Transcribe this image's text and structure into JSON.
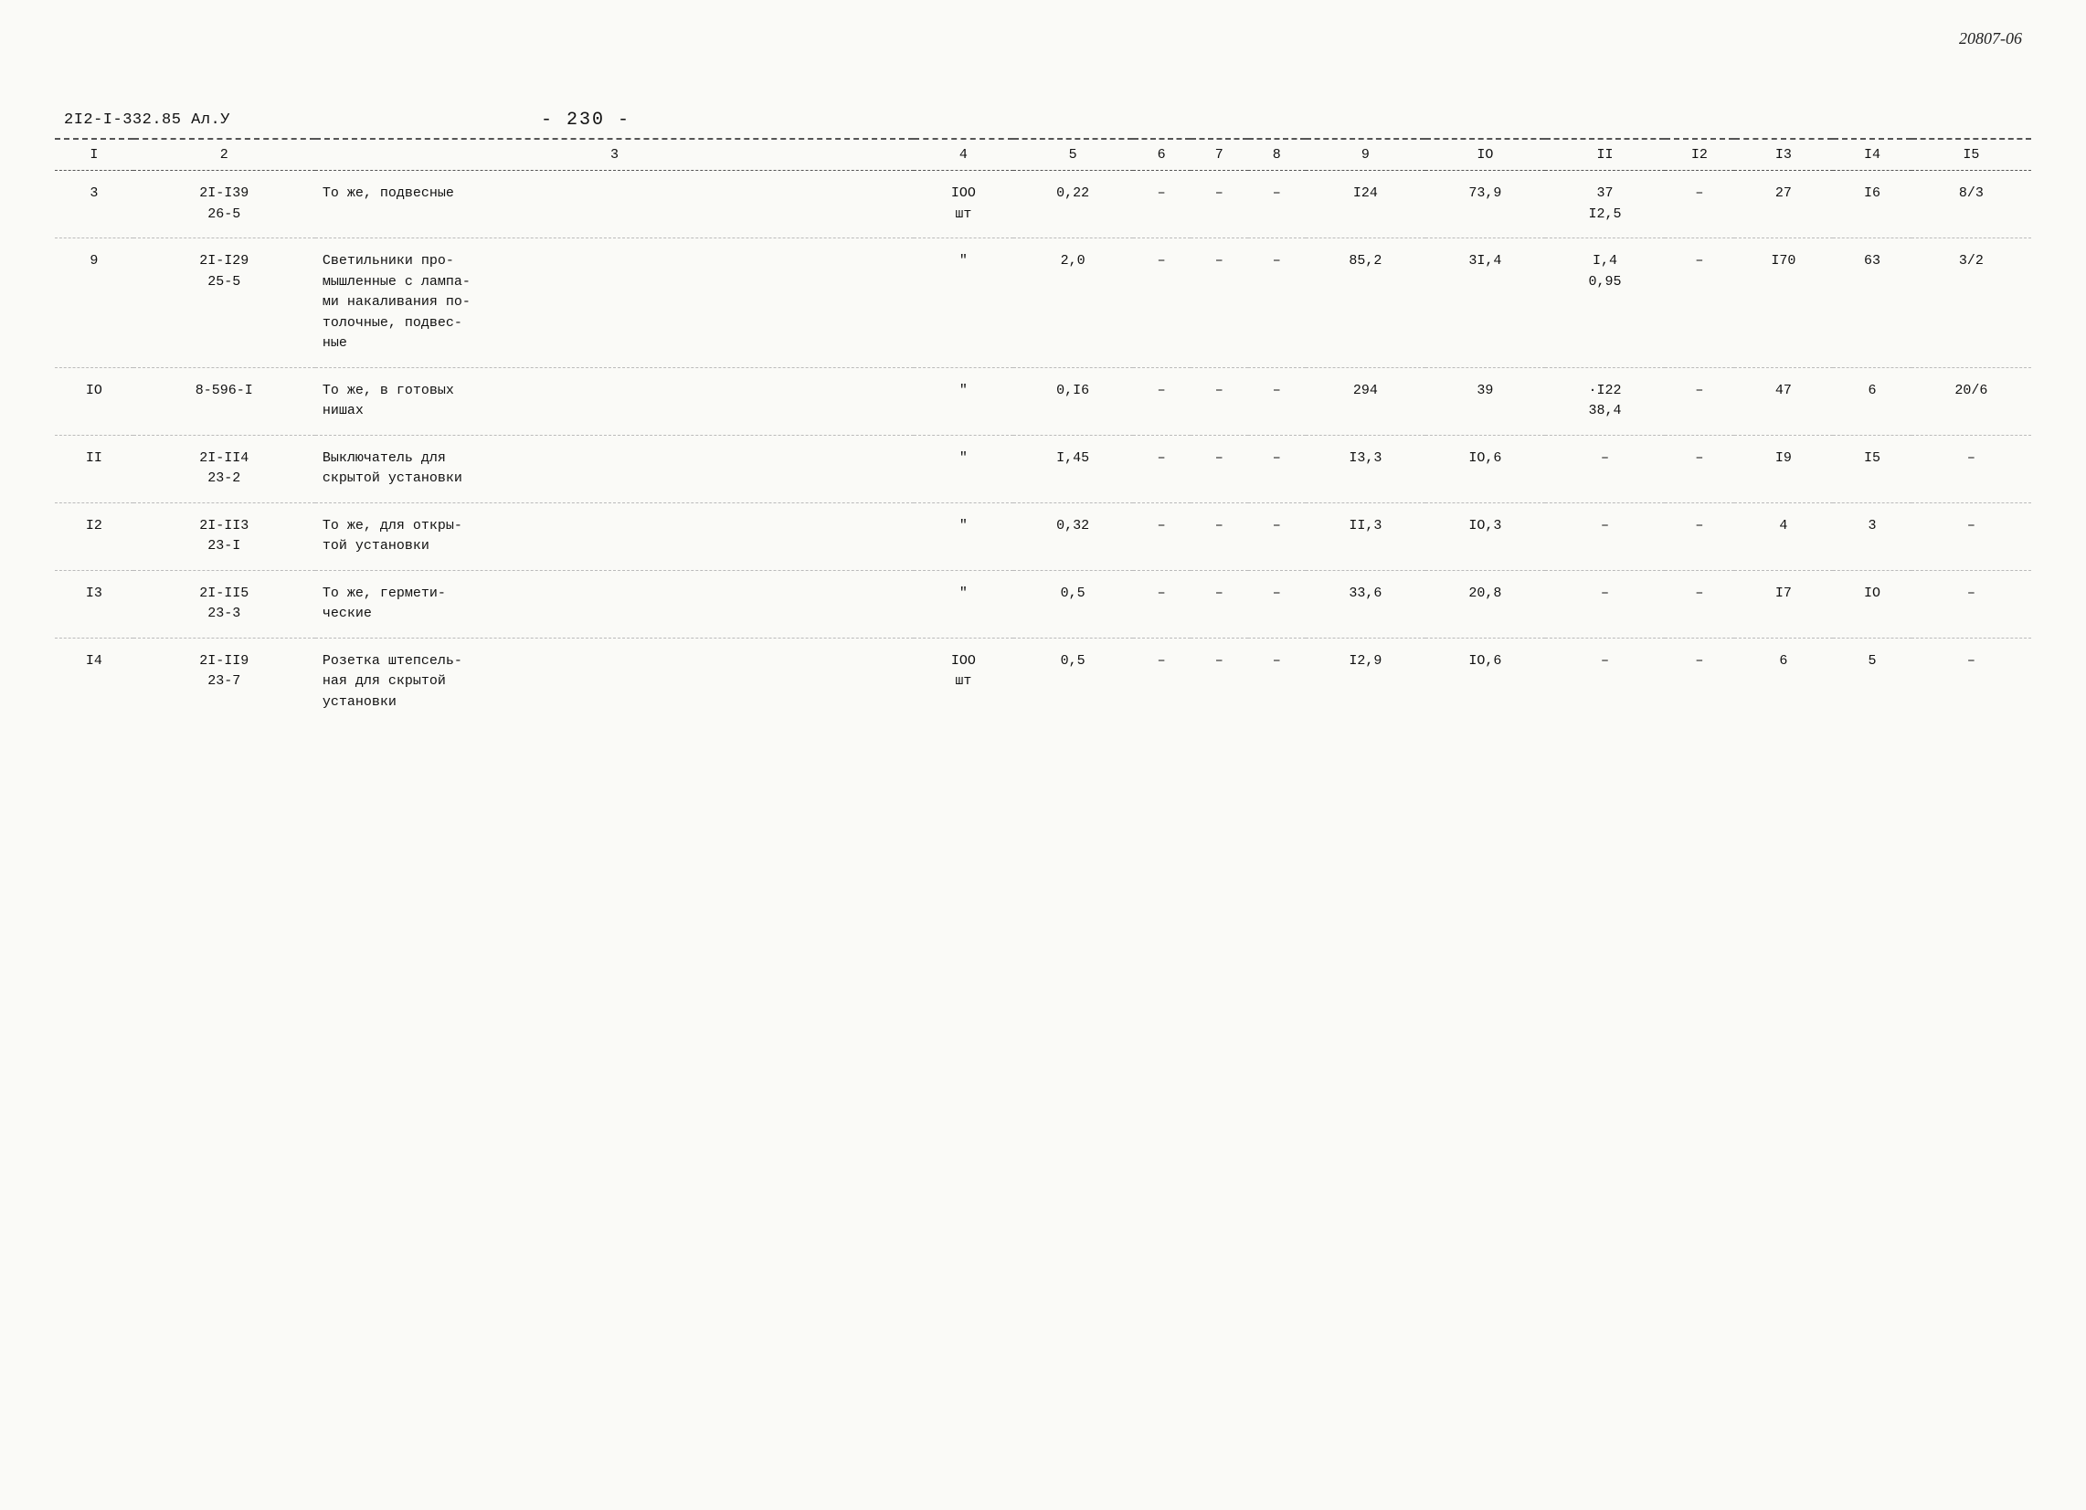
{
  "doc_number": "20807-06",
  "title_left": "2I2-I-332.85 Ал.У",
  "title_center": "- 230 -",
  "columns": [
    {
      "id": "col1",
      "label": "I"
    },
    {
      "id": "col2",
      "label": "2"
    },
    {
      "id": "col3",
      "label": "3"
    },
    {
      "id": "col4",
      "label": "4"
    },
    {
      "id": "col5",
      "label": "5"
    },
    {
      "id": "col6",
      "label": "6"
    },
    {
      "id": "col7",
      "label": "7"
    },
    {
      "id": "col8",
      "label": "8"
    },
    {
      "id": "col9",
      "label": "9"
    },
    {
      "id": "col10",
      "label": "IO"
    },
    {
      "id": "col11",
      "label": "II"
    },
    {
      "id": "col12",
      "label": "I2"
    },
    {
      "id": "col13",
      "label": "I3"
    },
    {
      "id": "col14",
      "label": "I4"
    },
    {
      "id": "col15",
      "label": "I5"
    }
  ],
  "rows": [
    {
      "id": "row3",
      "col1": "3",
      "col2": "2I-I39\n26-5",
      "col3": "То же, подвесные",
      "col4": "IOO\nшт",
      "col5": "0,22",
      "col6": "–",
      "col7": "–",
      "col8": "–",
      "col9": "I24",
      "col10": "73,9",
      "col11": "37\nI2,5",
      "col12": "–",
      "col13": "27",
      "col14": "I6",
      "col15": "8/3"
    },
    {
      "id": "row9",
      "col1": "9",
      "col2": "2I-I29\n25-5",
      "col3": "Светильники про-\nмышленные с лампа-\nми накаливания по-\nтолочные, подвес-\nные",
      "col4": "\"",
      "col5": "2,0",
      "col6": "–",
      "col7": "–",
      "col8": "–",
      "col9": "85,2",
      "col10": "3I,4",
      "col11": "I,4\n0,95",
      "col12": "–",
      "col13": "I70",
      "col14": "63",
      "col15": "3/2"
    },
    {
      "id": "row10",
      "col1": "IO",
      "col2": "8-596-I",
      "col3": "То же, в готовых\nнишах",
      "col4": "\"",
      "col5": "0,I6",
      "col6": "–",
      "col7": "–",
      "col8": "–",
      "col9": "294",
      "col10": "39",
      "col11": "·I22\n38,4",
      "col12": "–",
      "col13": "47",
      "col14": "6",
      "col15": "20/6"
    },
    {
      "id": "row11",
      "col1": "II",
      "col2": "2I-II4\n23-2",
      "col3": "Выключатель для\nскрытой установки",
      "col4": "\"",
      "col5": "I,45",
      "col6": "–",
      "col7": "–",
      "col8": "–",
      "col9": "I3,3",
      "col10": "IO,6",
      "col11": "–",
      "col12": "–",
      "col13": "I9",
      "col14": "I5",
      "col15": "–"
    },
    {
      "id": "row12",
      "col1": "I2",
      "col2": "2I-II3\n23-I",
      "col3": "То же, для откры-\nтой установки",
      "col4": "\"",
      "col5": "0,32",
      "col6": "–",
      "col7": "–",
      "col8": "–",
      "col9": "II,3",
      "col10": "IO,3",
      "col11": "–",
      "col12": "–",
      "col13": "4",
      "col14": "3",
      "col15": "–"
    },
    {
      "id": "row13",
      "col1": "I3",
      "col2": "2I-II5\n23-3",
      "col3": "То же, гермети-\nческие",
      "col4": "\"",
      "col5": "0,5",
      "col6": "–",
      "col7": "–",
      "col8": "–",
      "col9": "33,6",
      "col10": "20,8",
      "col11": "–",
      "col12": "–",
      "col13": "I7",
      "col14": "IO",
      "col15": "–"
    },
    {
      "id": "row14",
      "col1": "I4",
      "col2": "2I-II9\n23-7",
      "col3": "Розетка штепсель-\nная для скрытой\nустановки",
      "col4": "IOO\nшт",
      "col5": "0,5",
      "col6": "–",
      "col7": "–",
      "col8": "–",
      "col9": "I2,9",
      "col10": "IO,6",
      "col11": "–",
      "col12": "–",
      "col13": "6",
      "col14": "5",
      "col15": "–"
    }
  ]
}
